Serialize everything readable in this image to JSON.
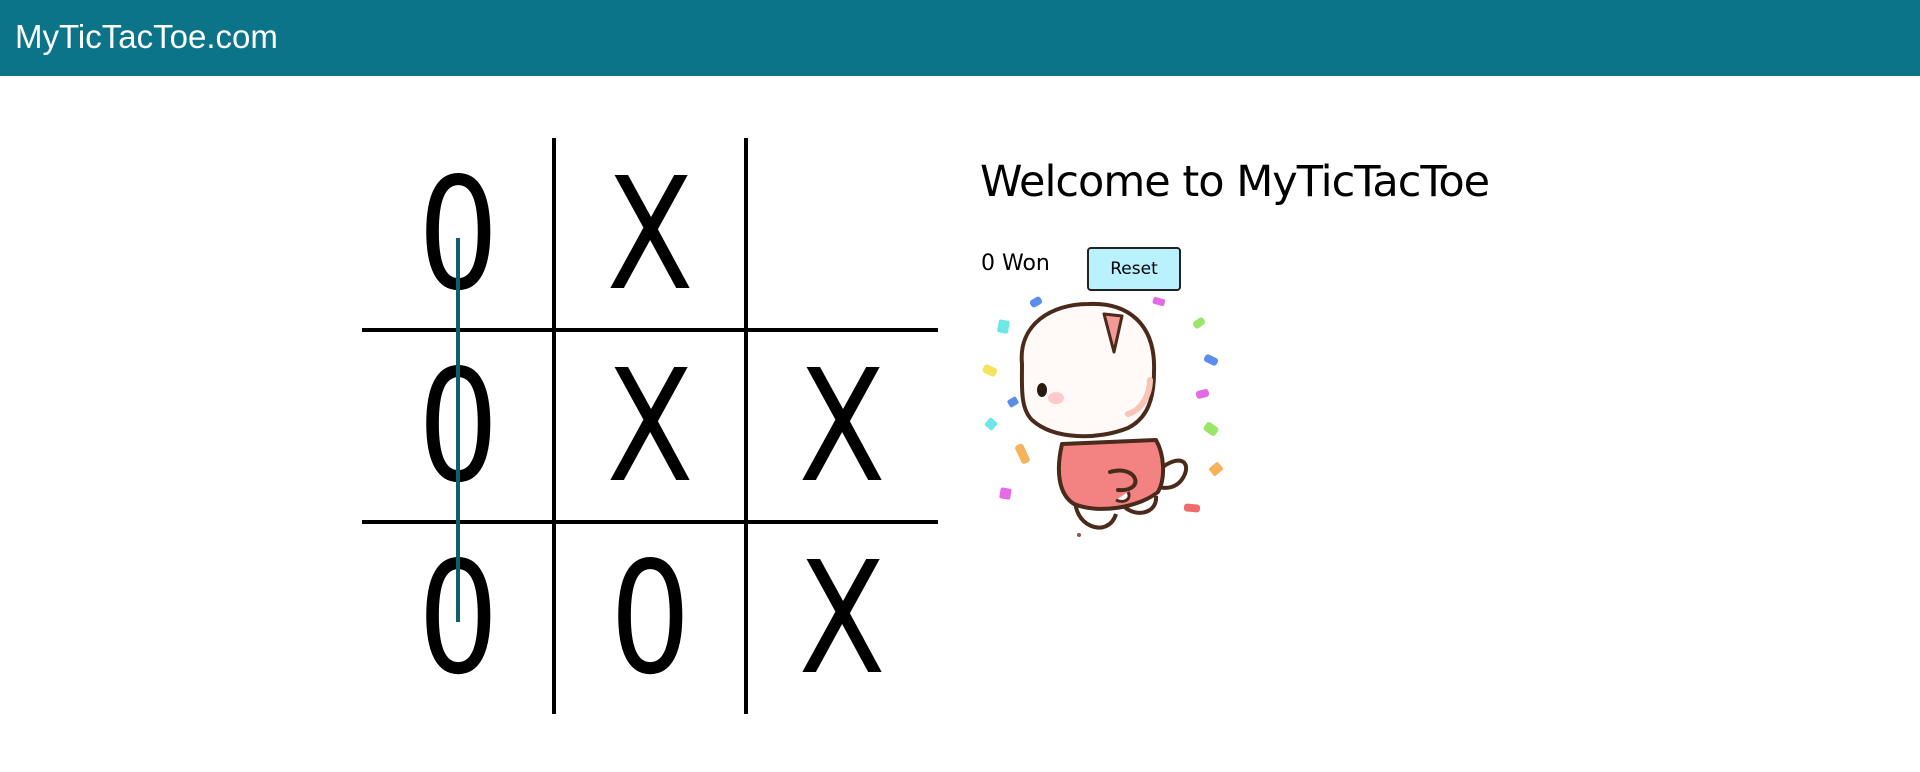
{
  "header": {
    "brand": "MyTicTacToe.com",
    "background_color": "#0b7489"
  },
  "board": {
    "cells": [
      "0",
      "X",
      "",
      "0",
      "X",
      "X",
      "0",
      "0",
      "X"
    ],
    "winning_line": "column-1",
    "winning_line_color": "#0f5f6a"
  },
  "panel": {
    "title": "Welcome to MyTicTacToe",
    "status": "0 Won",
    "reset_label": "Reset",
    "reset_color": "#b9f2fc",
    "illustration": "celebrating-cat-with-confetti"
  }
}
